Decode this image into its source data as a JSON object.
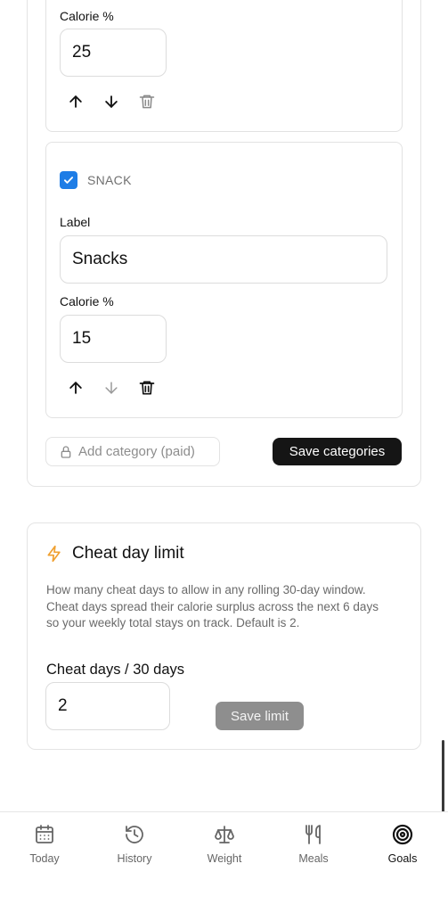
{
  "categories": {
    "items": [
      {
        "calorie_label": "Calorie %",
        "calorie_value": "25"
      },
      {
        "tag": "SNACK",
        "checked": true,
        "label_title": "Label",
        "label_value": "Snacks",
        "calorie_label": "Calorie %",
        "calorie_value": "15"
      }
    ],
    "add_button": "Add category (paid)",
    "save_button": "Save categories"
  },
  "cheat_day": {
    "title": "Cheat day limit",
    "description": "How many cheat days to allow in any rolling 30-day window. Cheat days spread their calorie surplus across the next 6 days so your weekly total stays on track. Default is 2.",
    "field_label": "Cheat days / 30 days",
    "field_value": "2",
    "save_button": "Save limit"
  },
  "colors": {
    "accent_blue": "#1e7de6",
    "accent_orange": "#f0a030",
    "button_dark": "#151515",
    "button_disabled": "#8e8e8e"
  },
  "nav": {
    "items": [
      {
        "label": "Today",
        "icon": "calendar-icon",
        "active": false
      },
      {
        "label": "History",
        "icon": "history-icon",
        "active": false
      },
      {
        "label": "Weight",
        "icon": "scale-icon",
        "active": false
      },
      {
        "label": "Meals",
        "icon": "utensils-icon",
        "active": false
      },
      {
        "label": "Goals",
        "icon": "target-icon",
        "active": true
      }
    ]
  }
}
